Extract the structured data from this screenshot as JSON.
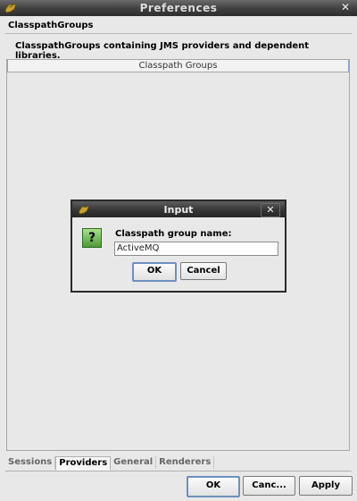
{
  "window": {
    "title": "Preferences",
    "close_glyph": "✕"
  },
  "section": {
    "title": "ClasspathGroups",
    "description": "ClasspathGroups containing JMS providers and dependent libraries."
  },
  "panel": {
    "column_header": "Classpath Groups"
  },
  "tabs": [
    {
      "label": "Sessions",
      "active": false
    },
    {
      "label": "Providers",
      "active": true
    },
    {
      "label": "General",
      "active": false
    },
    {
      "label": "Renderers",
      "active": false
    }
  ],
  "buttons": {
    "ok": "OK",
    "cancel": "Canc...",
    "apply": "Apply"
  },
  "dialog": {
    "title": "Input",
    "close_glyph": "✕",
    "icon": "question-icon",
    "icon_glyph": "?",
    "label": "Classpath group name:",
    "input_value": "ActiveMQ",
    "ok": "OK",
    "cancel": "Cancel"
  },
  "colors": {
    "titlebar": "#3f3f3f",
    "background": "#e8e8e8",
    "default_button_border": "#6f8fbf",
    "question_icon": "#4c9a34"
  }
}
